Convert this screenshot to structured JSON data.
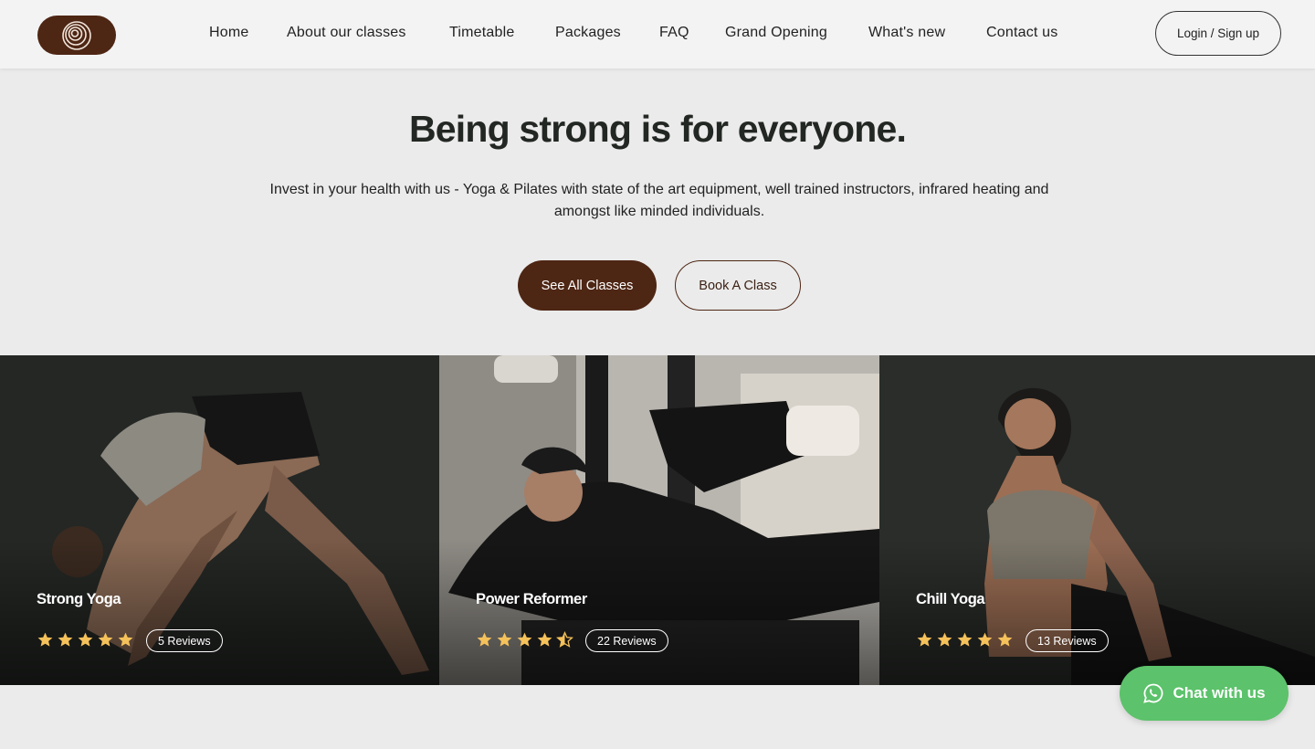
{
  "header": {
    "logo": "spiral-logo",
    "nav": [
      {
        "label": "Home"
      },
      {
        "label": "About our classes"
      },
      {
        "label": "Timetable"
      },
      {
        "label": "Packages"
      },
      {
        "label": "FAQ"
      },
      {
        "label": "Grand Opening"
      },
      {
        "label": "What's new"
      },
      {
        "label": "Contact us"
      }
    ],
    "login_label": "Login / Sign up"
  },
  "hero": {
    "title": "Being strong is for everyone.",
    "subtitle": "Invest in your health with us - Yoga & Pilates with state of the art equipment, well trained instructors, infrared heating and amongst like minded individuals.",
    "primary_button": "See All Classes",
    "secondary_button": "Book A Class"
  },
  "classes": [
    {
      "title": "Strong Yoga",
      "rating": 5,
      "reviews": "5 Reviews"
    },
    {
      "title": "Power Reformer",
      "rating": 4.5,
      "reviews": "22 Reviews"
    },
    {
      "title": "Chill Yoga",
      "rating": 5,
      "reviews": "13 Reviews"
    }
  ],
  "chat": {
    "label": "Chat with us",
    "icon": "whatsapp-icon"
  },
  "colors": {
    "brand": "#4e2614",
    "background": "#ebebeb",
    "star": "#f5c15a",
    "chat": "#5cc26b"
  }
}
